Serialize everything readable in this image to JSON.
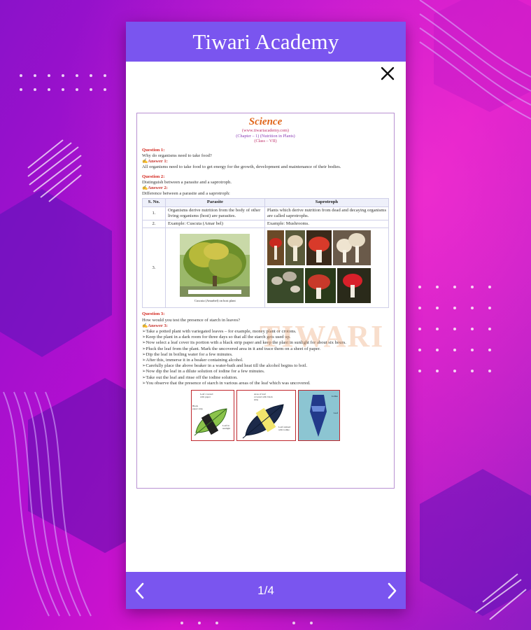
{
  "app": {
    "title": "Tiwari Academy"
  },
  "doc": {
    "title": "Science",
    "site": "(www.tiwariacademy.com)",
    "chapter": "(Chapter – 1) (Nutrition in Plants)",
    "class": "(Class – VII)",
    "q1_label": "Question 1:",
    "q1_text": "Why do organisms need to take food?",
    "a1_label": "Answer 1:",
    "a1_text": "All organisms need to take food to get energy for the growth, development and maintenance of their bodies.",
    "q2_label": "Question 2:",
    "q2_text": "Distinguish between a parasite and a saprotroph.",
    "a2_label": "Answer 2:",
    "a2_text": "Difference between a parasite and a saprotroph:",
    "table": {
      "headers": [
        "S. No.",
        "Parasite",
        "Saprotroph"
      ],
      "rows": [
        {
          "no": "1.",
          "parasite": "Organisms derive nutrition from the body of other living organisms (host) are parasites.",
          "saprotroph": "Plants which derive nutrition from dead and decaying organisms are called saprotrophs."
        },
        {
          "no": "2.",
          "parasite": "Example: Cuscuta (Amar bel)",
          "saprotroph": "Example: Mushrooms."
        },
        {
          "no": "3.",
          "parasite": "",
          "saprotroph": ""
        }
      ],
      "image_caption": "Cuscuta (Amarbel) on host plant"
    },
    "q3_label": "Question 3:",
    "q3_text": "How would you test the presence of starch in leaves?",
    "a3_label": "Answer 3:",
    "steps": [
      "Take a potted plant with variegated leaves – for example, money plant or crotons.",
      "Keep the plant in a dark room for three days so that all the starch gets used up.",
      "Now select a leaf cover its portion with a black strip paper and keep the plant in sunlight for about six hours.",
      "Pluck the leaf from the plant. Mark the uncovered area in it and trace them on a sheet of paper.",
      "Dip the leaf in boiling water for a few minutes.",
      "After this, immerse it in a beaker containing alcohol.",
      "Carefully place the above beaker in a water-bath and heat till the alcohol begins to boil.",
      "Now dip the leaf in a dilute solution of iodine for a few minutes.",
      "Take out the leaf and rinse off the iodine solution.",
      "You observe that the presence of starch in various areas of the leaf which was uncovered."
    ],
    "diagram_labels": {
      "d1": [
        "Leaf covered with paper",
        "Black paper strip",
        "Leaf in sunlight"
      ],
      "d2": [
        "Area of leaf covered with black strip",
        "Leaf stained with iodine"
      ],
      "d3": [
        "Iodine",
        "Leaf"
      ]
    },
    "watermark": "TIWARI"
  },
  "footer": {
    "page_indicator": "1/4"
  },
  "colors": {
    "accent": "#7a55ef",
    "science_title": "#e0661a",
    "question": "#d4281f",
    "border": "#b991d2"
  },
  "icons": {
    "close": "close-icon",
    "prev": "chevron-left-icon",
    "next": "chevron-right-icon"
  }
}
